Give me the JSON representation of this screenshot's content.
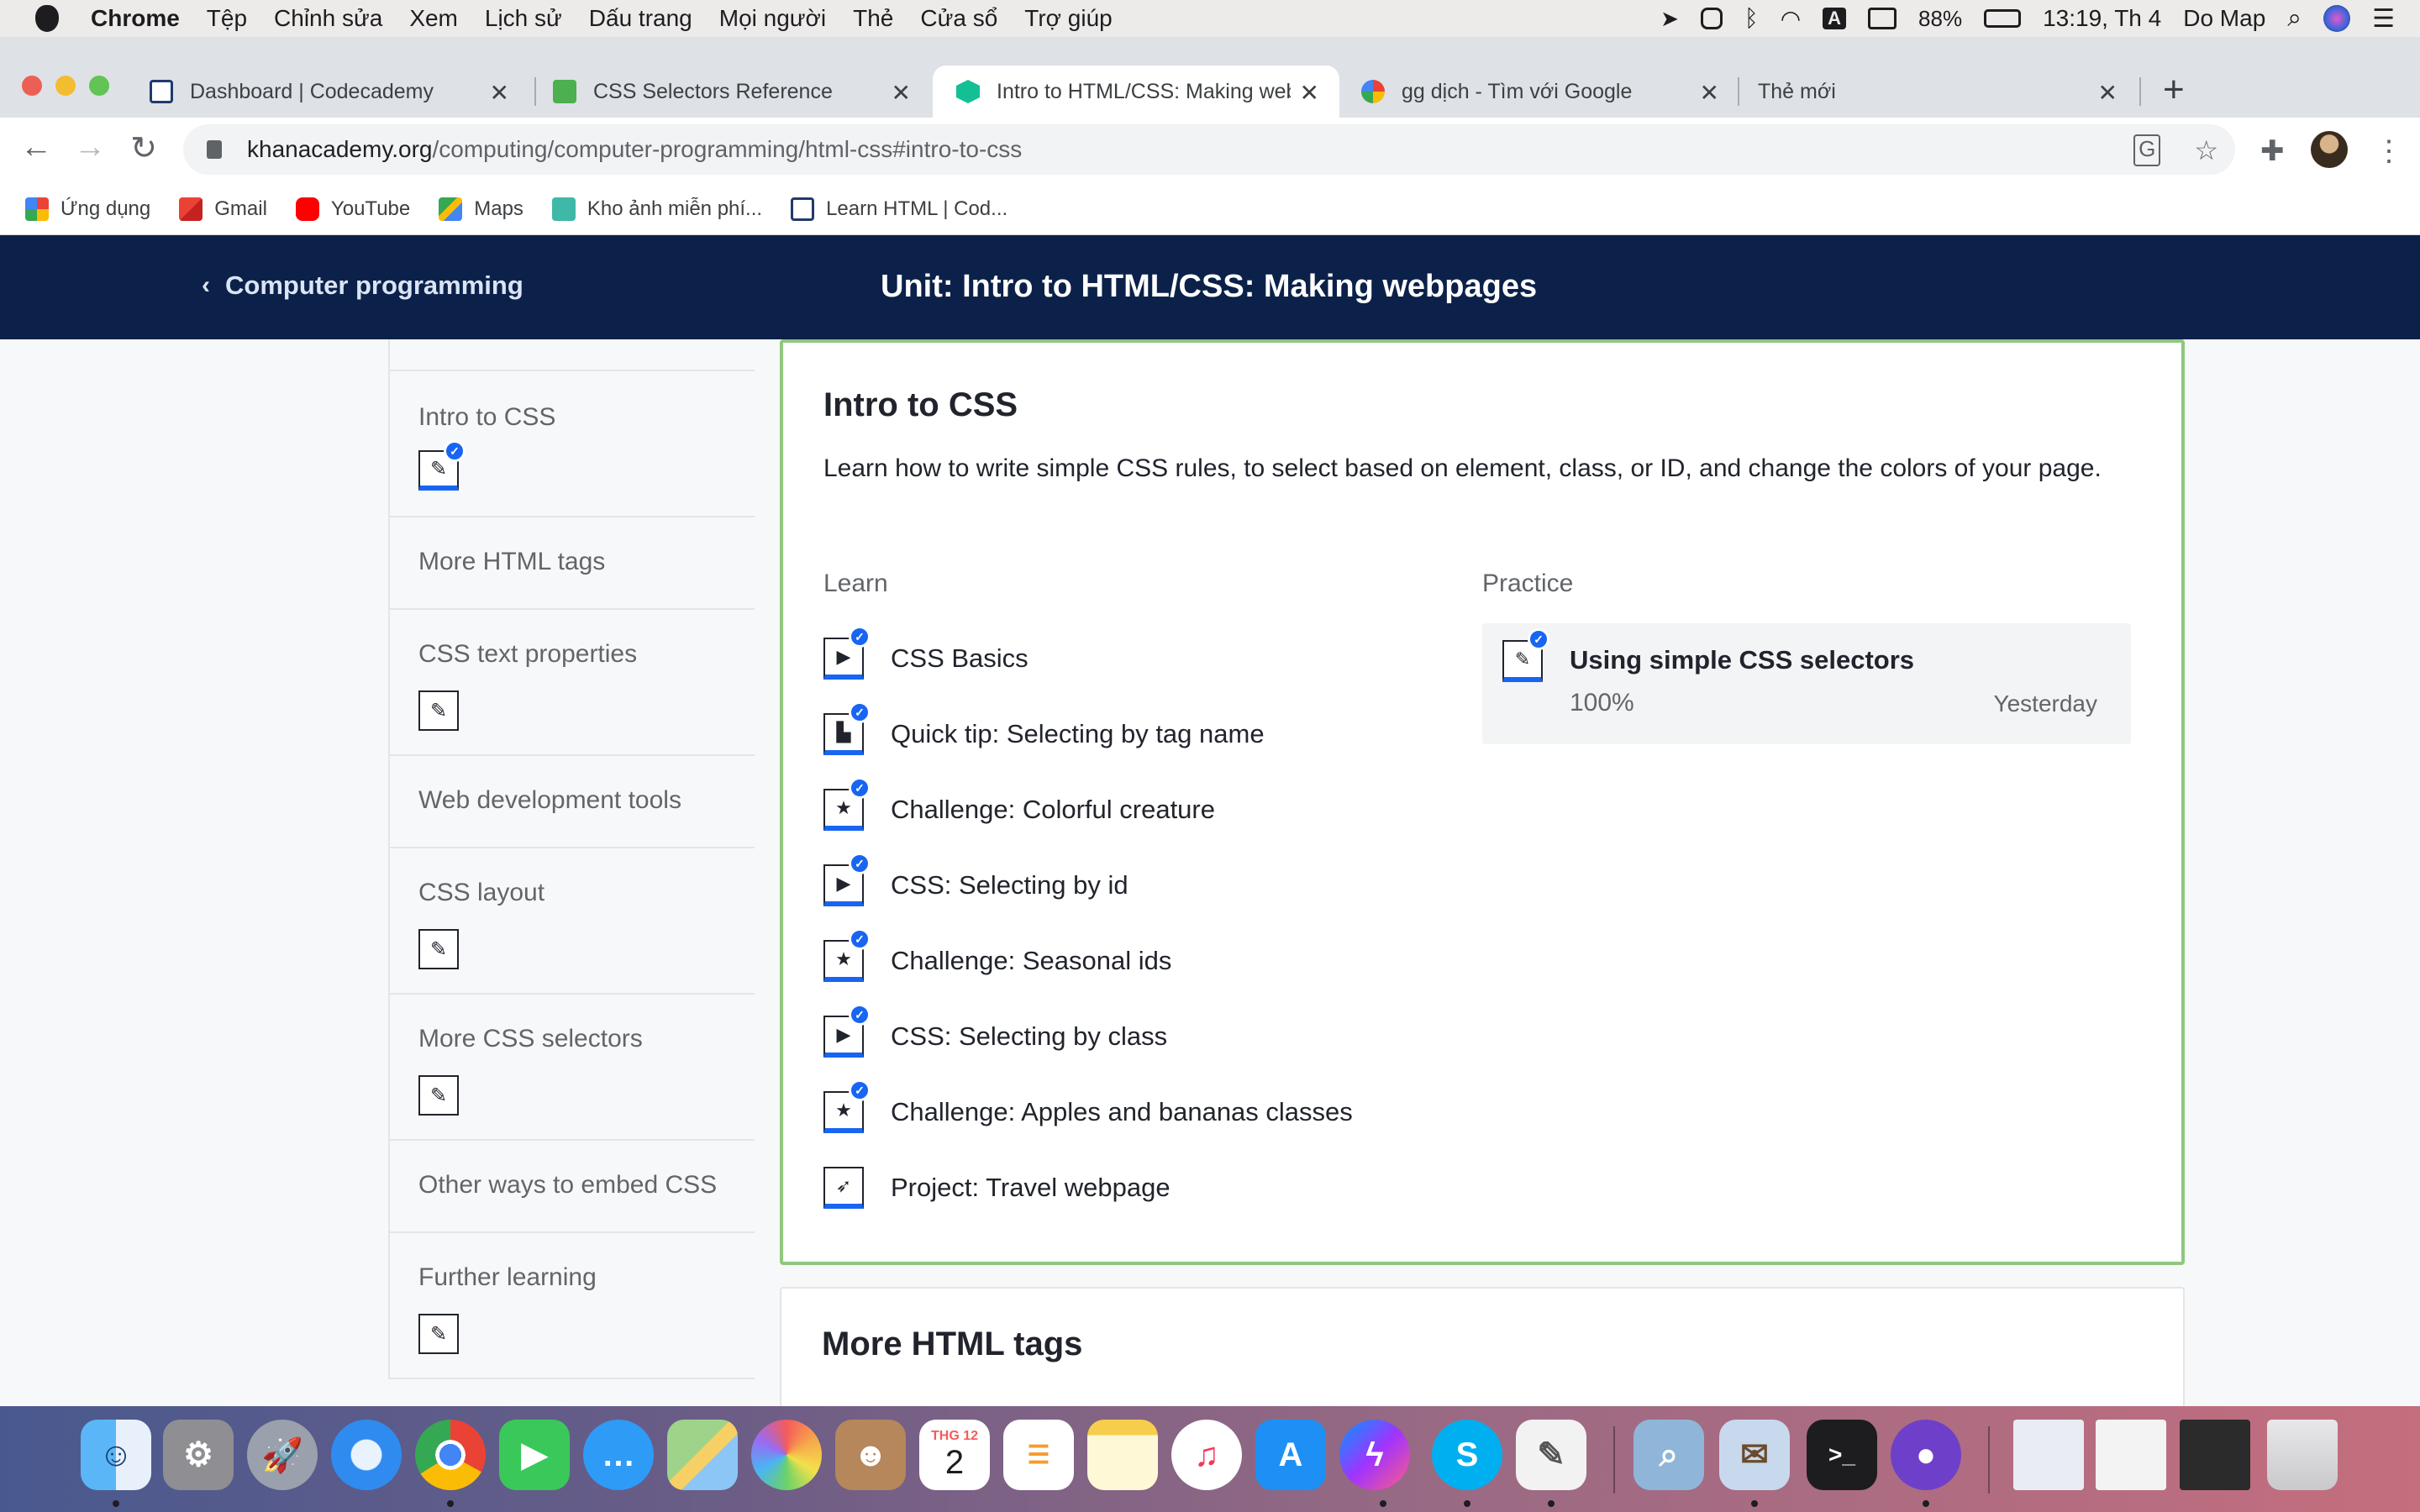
{
  "menubar": {
    "app": "Chrome",
    "items": [
      "Tệp",
      "Chỉnh sửa",
      "Xem",
      "Lịch sử",
      "Dấu trang",
      "Mọi người",
      "Thẻ",
      "Cửa sổ",
      "Trợ giúp"
    ],
    "status": {
      "input_source": "A",
      "battery": "88%",
      "time": "13:19, Th 4",
      "user": "Do Map"
    }
  },
  "tabs": [
    {
      "title": "Dashboard | Codecademy",
      "favicon": "codecademy-icon",
      "active": false
    },
    {
      "title": "CSS Selectors Reference",
      "favicon": "w3schools-icon",
      "active": false
    },
    {
      "title": "Intro to HTML/CSS: Making web",
      "favicon": "khan-academy-icon",
      "active": true
    },
    {
      "title": "gg dịch - Tìm với Google",
      "favicon": "google-icon",
      "active": false
    },
    {
      "title": "Thẻ mới",
      "favicon": "",
      "active": false
    }
  ],
  "address": {
    "host": "khanacademy.org",
    "path": "/computing/computer-programming/html-css#intro-to-css"
  },
  "bookmarks": [
    {
      "label": "Ứng dụng",
      "icon": "apps-grid-icon"
    },
    {
      "label": "Gmail",
      "icon": "gmail-icon"
    },
    {
      "label": "YouTube",
      "icon": "youtube-icon"
    },
    {
      "label": "Maps",
      "icon": "maps-icon"
    },
    {
      "label": "Kho ảnh miễn phí...",
      "icon": "freepik-icon"
    },
    {
      "label": "Learn HTML | Cod...",
      "icon": "codecademy-icon"
    }
  ],
  "header": {
    "back_label": "Computer programming",
    "unit_title": "Unit: Intro to HTML/CSS: Making webpages"
  },
  "sidebar": [
    {
      "label": "Intro to CSS",
      "has_icon": true,
      "done": true
    },
    {
      "label": "More HTML tags",
      "has_icon": false
    },
    {
      "label": "CSS text properties",
      "has_icon": true,
      "done": false
    },
    {
      "label": "Web development tools",
      "has_icon": false
    },
    {
      "label": "CSS layout",
      "has_icon": true,
      "done": false
    },
    {
      "label": "More CSS selectors",
      "has_icon": true,
      "done": false
    },
    {
      "label": "Other ways to embed CSS",
      "has_icon": false
    },
    {
      "label": "Further learning",
      "has_icon": true,
      "done": false
    }
  ],
  "card": {
    "title": "Intro to CSS",
    "description": "Learn how to write simple CSS rules, to select based on element, class, or ID, and change the colors of your page.",
    "learn_label": "Learn",
    "practice_label": "Practice",
    "lessons": [
      {
        "label": "CSS Basics",
        "icon": "video-play-icon",
        "done": true
      },
      {
        "label": "Quick tip: Selecting by tag name",
        "icon": "article-icon",
        "done": true
      },
      {
        "label": "Challenge: Colorful creature",
        "icon": "star-icon",
        "done": true
      },
      {
        "label": "CSS: Selecting by id",
        "icon": "video-play-icon",
        "done": true
      },
      {
        "label": "Challenge: Seasonal ids",
        "icon": "star-icon",
        "done": true
      },
      {
        "label": "CSS: Selecting by class",
        "icon": "video-play-icon",
        "done": true
      },
      {
        "label": "Challenge: Apples and bananas classes",
        "icon": "star-icon",
        "done": true
      },
      {
        "label": "Project: Travel webpage",
        "icon": "rocket-icon",
        "done": false
      }
    ],
    "practice": {
      "title": "Using simple CSS selectors",
      "percent": "100%",
      "when": "Yesterday"
    }
  },
  "next_card": {
    "title": "More HTML tags"
  },
  "dock": [
    "finder-icon",
    "system-preferences-icon",
    "launchpad-icon",
    "safari-icon",
    "chrome-icon",
    "facetime-icon",
    "messages-icon",
    "maps-icon",
    "photos-icon",
    "contacts-icon",
    "calendar-icon",
    "reminders-icon",
    "notes-icon",
    "music-icon",
    "app-store-icon",
    "messenger-icon",
    "skype-icon",
    "textedit-icon",
    "preview-icon",
    "mail-icon",
    "terminal-icon",
    "github-icon",
    "window-thumb-icon",
    "window-thumb-icon",
    "window-thumb-icon",
    "trash-icon"
  ],
  "calendar": {
    "month": "THG 12",
    "day": "2"
  },
  "colors": {
    "header": "#0b2149",
    "accent": "#1865f2",
    "card_border": "#8fc77d"
  }
}
